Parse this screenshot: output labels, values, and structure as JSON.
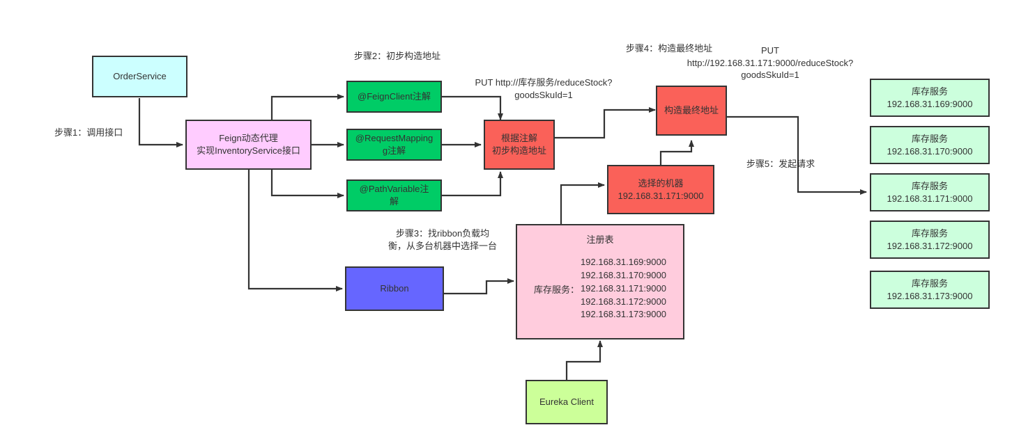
{
  "diagram": {
    "title": "Feign + Ribbon request flow",
    "colors": {
      "cyan": "#ccffff",
      "pink": "#ffccff",
      "green": "#00cc66",
      "red": "#fa6159",
      "blue": "#6666ff",
      "mint": "#ccffdd",
      "lime": "#ccff99",
      "lightpink": "#ffccdd",
      "stroke": "#333333"
    }
  },
  "nodes": {
    "order_service": "OrderService",
    "feign_proxy": "Feign动态代理\n实现InventoryService接口",
    "feign_client_annotation": "@FeignClient注解",
    "request_mapping_annotation": "@RequestMapping\ng注解",
    "path_variable_annotation": "@PathVariable注\n解",
    "build_initial_address": "根据注解\n初步构造地址",
    "build_final_address": "构造最终地址",
    "selected_machine": "选择的机器\n192.168.31.171:9000",
    "ribbon": "Ribbon",
    "eureka_client": "Eureka Client"
  },
  "registry": {
    "title": "注册表",
    "key": "库存服务：",
    "values": "192.168.31.169:9000\n192.168.31.170:9000\n192.168.31.171:9000\n192.168.31.172:9000\n192.168.31.173:9000"
  },
  "services": [
    {
      "name": "库存服务",
      "address": "192.168.31.169:9000"
    },
    {
      "name": "库存服务",
      "address": "192.168.31.170:9000"
    },
    {
      "name": "库存服务",
      "address": "192.168.31.171:9000"
    },
    {
      "name": "库存服务",
      "address": "192.168.31.172:9000"
    },
    {
      "name": "库存服务",
      "address": "192.168.31.173:9000"
    }
  ],
  "labels": {
    "step1": "步骤1：调用接口",
    "step2": "步骤2：初步构造地址",
    "step3": "步骤3：找ribbon负载均\n衡，从多台机器中选择一台",
    "step4": "步骤4：构造最终地址",
    "step5": "步骤5：发起请求",
    "put_service_url": "PUT http://库存服务/reduceStock?\ngoodsSkuId=1",
    "put_final_url": "PUT\nhttp://192.168.31.171:9000/reduceStock?\ngoodsSkuId=1"
  }
}
